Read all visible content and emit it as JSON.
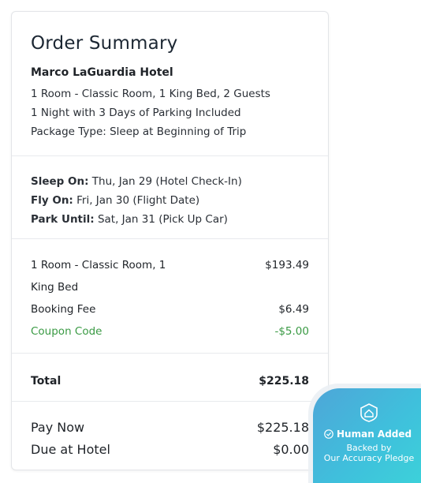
{
  "order": {
    "title": "Order Summary",
    "hotel_name": "Marco LaGuardia Hotel",
    "room_line": "1 Room - Classic Room, 1 King Bed, 2 Guests",
    "nights_line": "1 Night with 3 Days of Parking Included",
    "package_line": "Package Type: Sleep at Beginning of Trip"
  },
  "schedule": {
    "sleep_label": "Sleep On:",
    "sleep_value": " Thu, Jan 29 (Hotel Check-In)",
    "fly_label": "Fly On:",
    "fly_value": " Fri, Jan 30 (Flight Date)",
    "park_label": "Park Until:",
    "park_value": " Sat, Jan 31 (Pick Up Car)"
  },
  "charges": [
    {
      "label": "1 Room - Classic Room, 1",
      "amount": "$193.49"
    },
    {
      "label": "King Bed",
      "amount": ""
    },
    {
      "label": "Booking Fee",
      "amount": "$6.49"
    },
    {
      "label": "Coupon Code",
      "amount": "-$5.00"
    }
  ],
  "total": {
    "label": "Total",
    "amount": "$225.18"
  },
  "payment": {
    "pay_now_label": "Pay Now",
    "pay_now_amount": "$225.18",
    "due_label": "Due at Hotel",
    "due_amount": "$0.00"
  },
  "badge": {
    "icon": "shield-home-icon",
    "heading": "Human Added",
    "sub_line1": "Backed by",
    "sub_line2": "Our Accuracy Pledge"
  },
  "colors": {
    "coupon": "#3a9a44",
    "badge_start": "#4ea6d8",
    "badge_end": "#3cd3d9"
  }
}
